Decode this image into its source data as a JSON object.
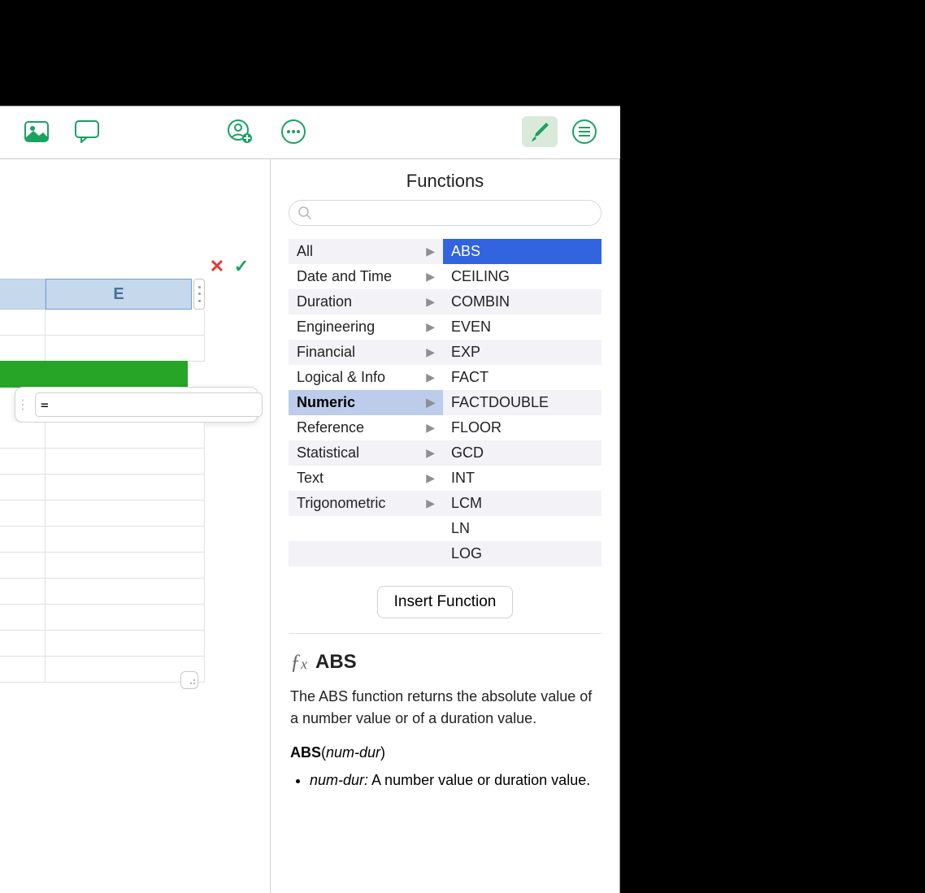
{
  "toolbar": {
    "icons": {
      "media": "media-icon",
      "comment": "comment-icon",
      "collaborate": "collaborate-icon",
      "more": "more-icon",
      "format": "format-paintbrush-icon",
      "organize": "organize-circle-icon"
    }
  },
  "sheet": {
    "column_header": "E",
    "formula_value": "="
  },
  "functions": {
    "title": "Functions",
    "search_placeholder": "",
    "categories": [
      "All",
      "Date and Time",
      "Duration",
      "Engineering",
      "Financial",
      "Logical & Info",
      "Numeric",
      "Reference",
      "Statistical",
      "Text",
      "Trigonometric"
    ],
    "selected_category": "Numeric",
    "list": [
      "ABS",
      "CEILING",
      "COMBIN",
      "EVEN",
      "EXP",
      "FACT",
      "FACTDOUBLE",
      "FLOOR",
      "GCD",
      "INT",
      "LCM",
      "LN",
      "LOG"
    ],
    "selected_function": "ABS",
    "insert_label": "Insert Function",
    "detail": {
      "name": "ABS",
      "description": "The ABS function returns the absolute value of a number value or of a duration value.",
      "signature_name": "ABS",
      "signature_arg": "num-dur",
      "arg_name": "num-dur:",
      "arg_desc": "A number value or duration value."
    }
  }
}
